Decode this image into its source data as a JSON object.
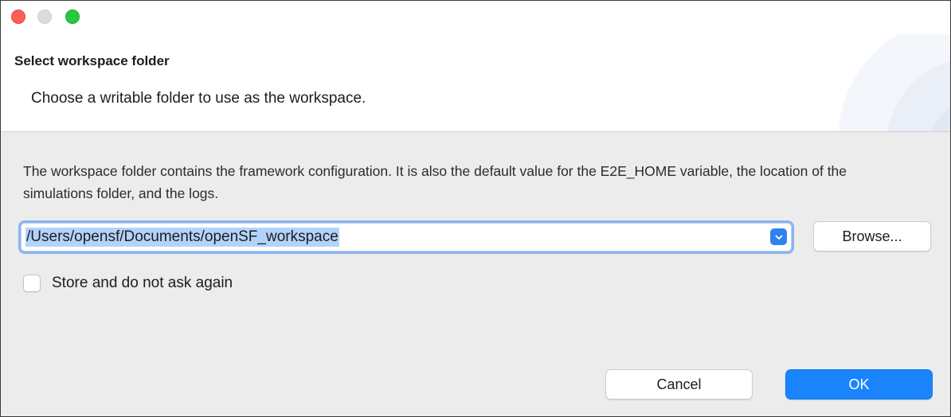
{
  "window": {
    "controls": {
      "close_icon": "close-circle-icon",
      "minimize_icon": "minimize-circle-icon",
      "zoom_icon": "zoom-circle-icon",
      "colors": {
        "close": "#fe5f57",
        "minimize": "#dcdcdc",
        "zoom": "#28c840"
      }
    }
  },
  "header": {
    "title": "Select workspace folder",
    "description": "Choose a writable folder to use as the workspace."
  },
  "body": {
    "info_text": "The workspace folder contains the framework configuration. It is also the default value for the E2E_HOME variable, the location of the simulations folder, and the logs.",
    "workspace_combo": {
      "value": "/Users/opensf/Documents/openSF_workspace",
      "arrow_icon": "chevron-updown-icon"
    },
    "browse_label": "Browse...",
    "remember_label": "Store and do not ask again",
    "remember_checked": false
  },
  "footer": {
    "cancel_label": "Cancel",
    "ok_label": "OK"
  },
  "colors": {
    "accent": "#1a84ff",
    "selection": "#b3d3fb",
    "focus_ring": "#8ab4ef"
  }
}
